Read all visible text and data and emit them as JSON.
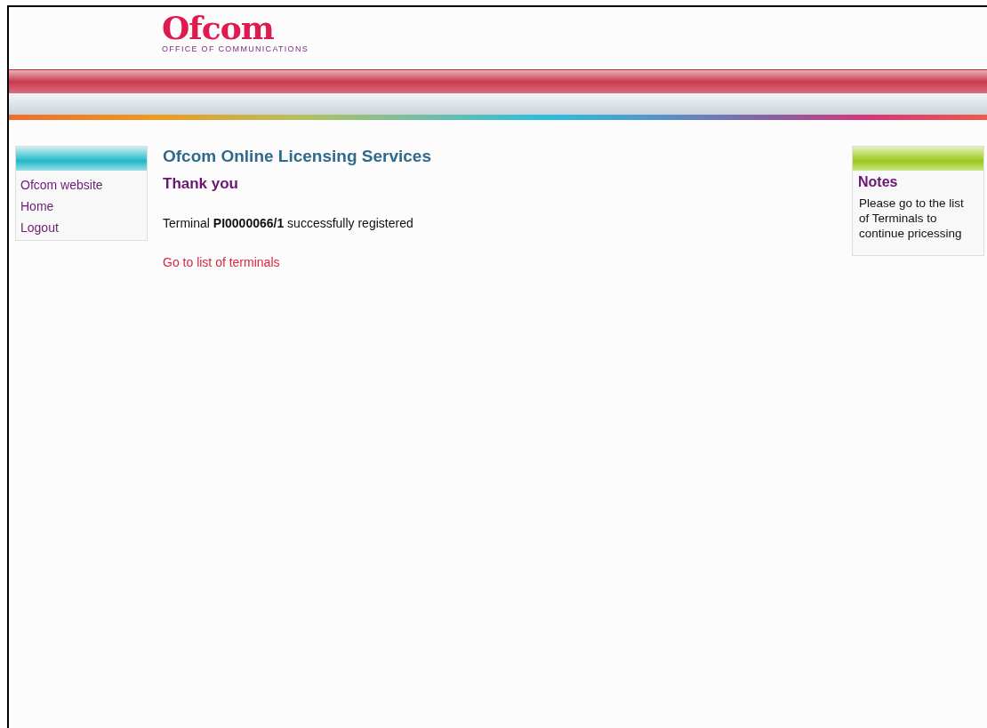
{
  "logo": {
    "wordmark": "Ofcom",
    "tagline": "OFFICE OF COMMUNICATIONS"
  },
  "sidebar": {
    "items": [
      {
        "label": "Ofcom website"
      },
      {
        "label": "Home"
      },
      {
        "label": "Logout"
      }
    ]
  },
  "main": {
    "title": "Ofcom Online Licensing Services",
    "heading": "Thank you",
    "message": "Terminal **PI0000066/1** successfully registered",
    "link": "Go to list of terminals"
  },
  "notes": {
    "title": "Notes",
    "text": "Please go to the list of Terminals to continue pricessing"
  }
}
